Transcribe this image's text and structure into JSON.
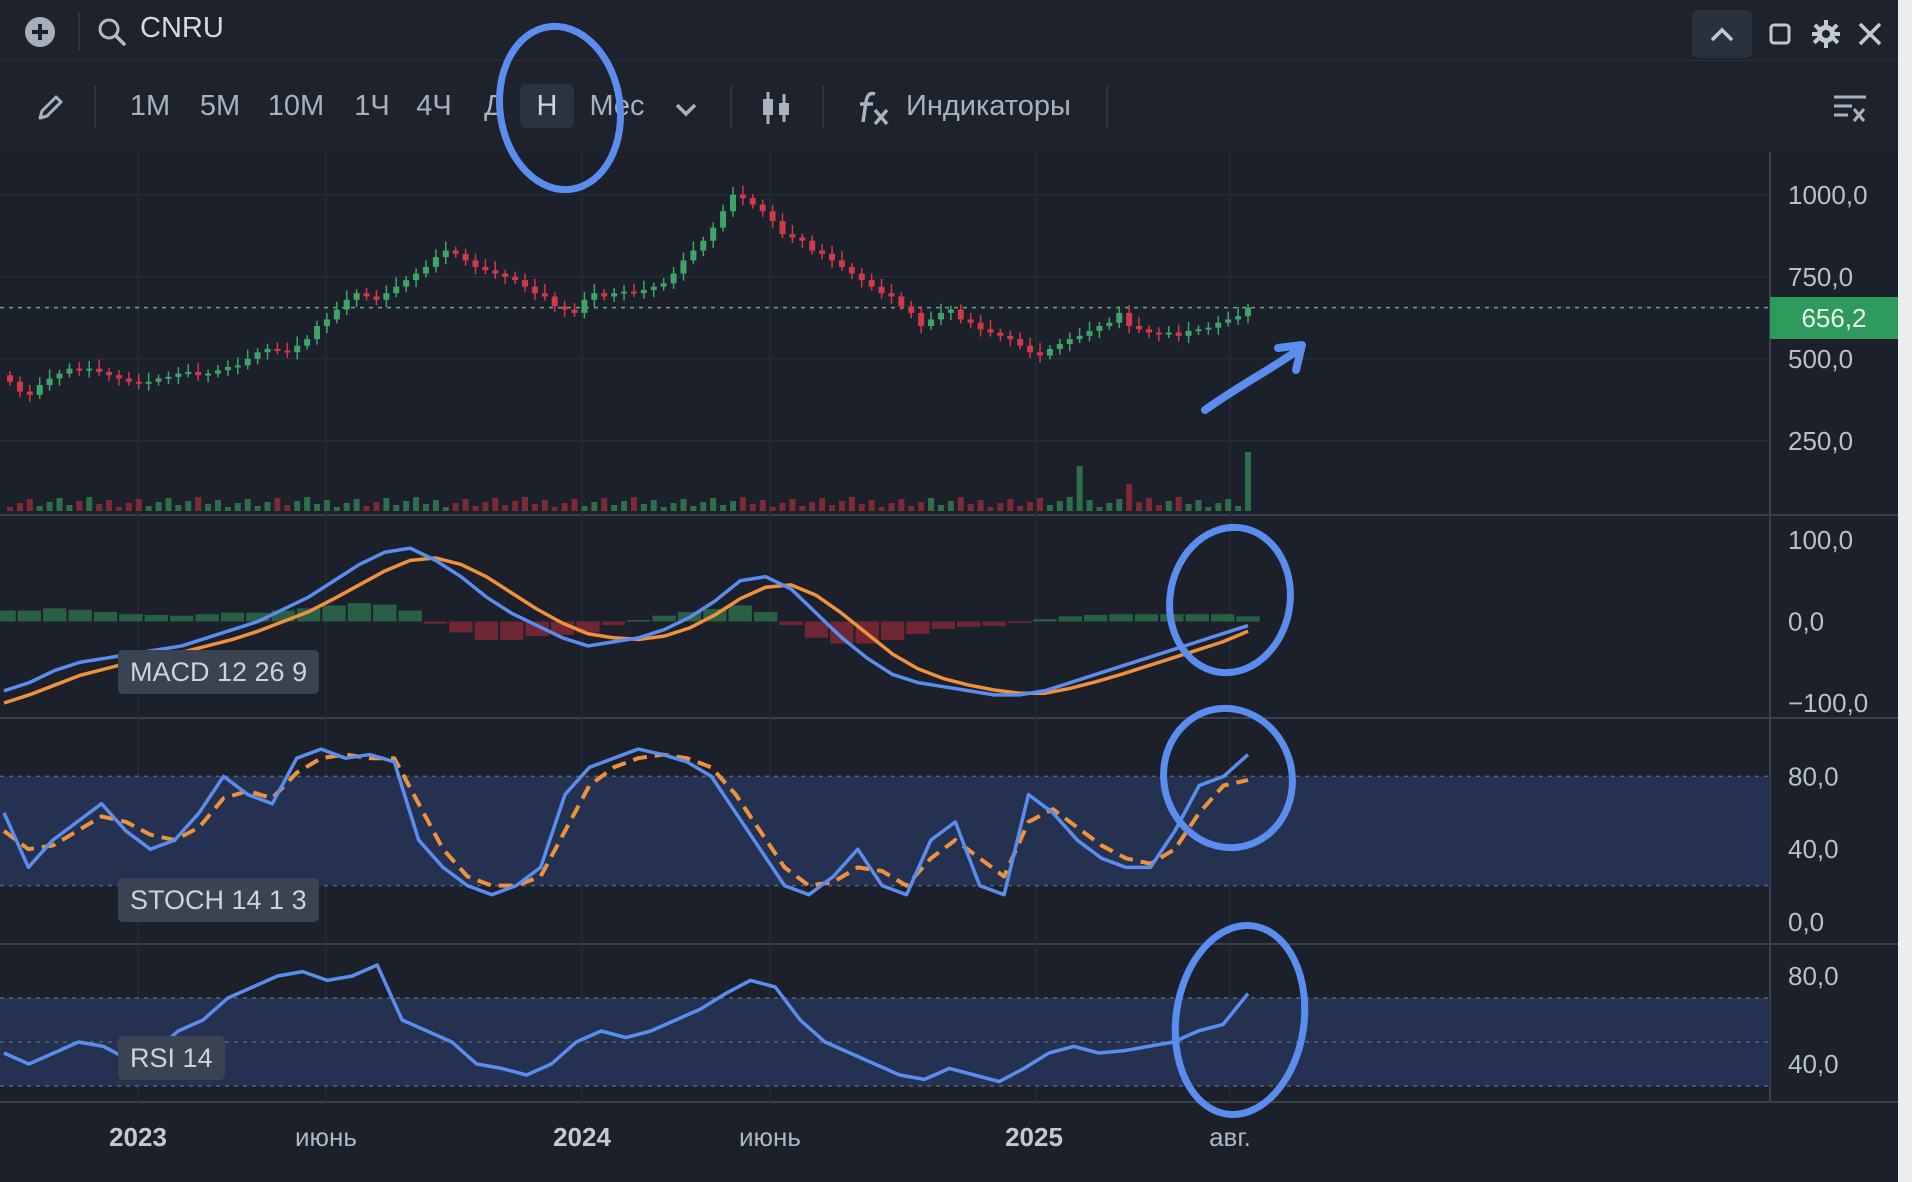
{
  "header": {
    "symbol": "CNRU",
    "icons": [
      "plus-circle-icon",
      "search-icon",
      "chevron-up-icon",
      "square-icon",
      "gear-icon",
      "close-icon"
    ]
  },
  "toolbar": {
    "timeframes": [
      "1М",
      "5М",
      "10М",
      "1Ч",
      "4Ч",
      "Д",
      "Н",
      "Мес"
    ],
    "active_timeframe": "Н",
    "indicators_label": "Индикаторы"
  },
  "price_axis": {
    "ticks": [
      "1000,0",
      "750,0",
      "500,0",
      "250,0"
    ],
    "current_price": "656,2",
    "current_price_color": "#2e9a5c"
  },
  "macd": {
    "label": "MACD 12 26 9",
    "ticks": [
      "100,0",
      "0,0",
      "−100,0"
    ],
    "line_color": "#5b8def",
    "signal_color": "#f0913c"
  },
  "stoch": {
    "label": "STOCH 14 1 3",
    "ticks": [
      "80,0",
      "40,0",
      "0,0"
    ]
  },
  "rsi": {
    "label": "RSI 14",
    "ticks": [
      "80,0",
      "40,0"
    ]
  },
  "x_axis": {
    "labels": [
      {
        "text": "2023",
        "bold": true
      },
      {
        "text": "июнь",
        "bold": false
      },
      {
        "text": "2024",
        "bold": true
      },
      {
        "text": "июнь",
        "bold": false
      },
      {
        "text": "2025",
        "bold": true
      },
      {
        "text": "авг.",
        "bold": false
      }
    ]
  },
  "chart_data": [
    {
      "type": "candlestick",
      "title": "CNRU",
      "ylim": [
        100,
        1100
      ],
      "close": [
        430,
        400,
        390,
        420,
        440,
        455,
        470,
        465,
        470,
        460,
        450,
        440,
        430,
        425,
        430,
        440,
        445,
        455,
        460,
        450,
        455,
        465,
        475,
        480,
        500,
        520,
        530,
        525,
        520,
        540,
        560,
        600,
        620,
        650,
        680,
        700,
        690,
        680,
        700,
        720,
        740,
        760,
        780,
        810,
        830,
        820,
        800,
        780,
        770,
        760,
        750,
        740,
        720,
        700,
        690,
        660,
        650,
        640,
        680,
        700,
        690,
        700,
        705,
        700,
        710,
        720,
        730,
        760,
        800,
        830,
        860,
        900,
        950,
        1000,
        990,
        970,
        950,
        920,
        880,
        870,
        860,
        830,
        820,
        800,
        780,
        760,
        740,
        720,
        700,
        690,
        660,
        640,
        600,
        620,
        640,
        650,
        620,
        610,
        590,
        580,
        570,
        560,
        540,
        520,
        510,
        530,
        545,
        560,
        570,
        585,
        600,
        610,
        640,
        600,
        590,
        580,
        575,
        580,
        570,
        585,
        590,
        595,
        610,
        620,
        630,
        656.2
      ],
      "volume_relative": "low, spikes near 2025-Q1 and latest bar"
    },
    {
      "type": "line",
      "title": "MACD 12 26 9",
      "ylim": [
        -100,
        100
      ],
      "series": [
        {
          "name": "MACD",
          "values": [
            -85,
            -75,
            -60,
            -50,
            -45,
            -40,
            -35,
            -30,
            -20,
            -10,
            0,
            15,
            30,
            50,
            70,
            85,
            90,
            75,
            55,
            30,
            10,
            -5,
            -20,
            -30,
            -25,
            -20,
            -10,
            5,
            25,
            50,
            55,
            40,
            10,
            -20,
            -45,
            -65,
            -75,
            -80,
            -85,
            -90,
            -90,
            -85,
            -75,
            -65,
            -55,
            -45,
            -35,
            -25,
            -15,
            -5
          ]
        },
        {
          "name": "Signal",
          "values": [
            -100,
            -90,
            -78,
            -66,
            -58,
            -50,
            -44,
            -38,
            -30,
            -22,
            -12,
            0,
            12,
            28,
            45,
            62,
            75,
            78,
            70,
            55,
            35,
            15,
            -2,
            -15,
            -20,
            -22,
            -18,
            -8,
            8,
            28,
            42,
            45,
            32,
            10,
            -15,
            -40,
            -58,
            -70,
            -78,
            -84,
            -88,
            -88,
            -82,
            -74,
            -65,
            -55,
            -45,
            -35,
            -25,
            -12
          ]
        }
      ]
    },
    {
      "type": "line",
      "title": "STOCH 14 1 3",
      "ylim": [
        0,
        100
      ],
      "series": [
        {
          "name": "%K",
          "values": [
            60,
            30,
            45,
            55,
            65,
            50,
            40,
            45,
            60,
            80,
            70,
            65,
            90,
            95,
            90,
            92,
            88,
            45,
            30,
            20,
            15,
            20,
            30,
            70,
            85,
            90,
            95,
            92,
            88,
            80,
            60,
            40,
            20,
            15,
            25,
            40,
            20,
            15,
            45,
            55,
            20,
            15,
            70,
            60,
            45,
            35,
            30,
            30,
            50,
            75,
            80,
            92
          ]
        },
        {
          "name": "%D",
          "values": [
            50,
            40,
            42,
            50,
            58,
            55,
            48,
            45,
            52,
            68,
            72,
            68,
            82,
            90,
            92,
            90,
            90,
            65,
            40,
            25,
            20,
            20,
            25,
            50,
            75,
            85,
            90,
            92,
            90,
            85,
            70,
            50,
            30,
            20,
            22,
            30,
            28,
            20,
            35,
            45,
            35,
            25,
            55,
            62,
            52,
            42,
            35,
            32,
            40,
            60,
            75,
            78
          ]
        }
      ]
    },
    {
      "type": "line",
      "title": "RSI 14",
      "ylim": [
        20,
        90
      ],
      "series": [
        {
          "name": "RSI",
          "values": [
            45,
            40,
            45,
            50,
            48,
            42,
            45,
            55,
            60,
            70,
            75,
            80,
            82,
            78,
            80,
            85,
            60,
            55,
            50,
            40,
            38,
            35,
            40,
            50,
            55,
            52,
            55,
            60,
            65,
            72,
            78,
            75,
            60,
            50,
            45,
            40,
            35,
            33,
            38,
            35,
            32,
            38,
            45,
            48,
            45,
            46,
            48,
            50,
            55,
            58,
            72
          ]
        }
      ]
    }
  ]
}
